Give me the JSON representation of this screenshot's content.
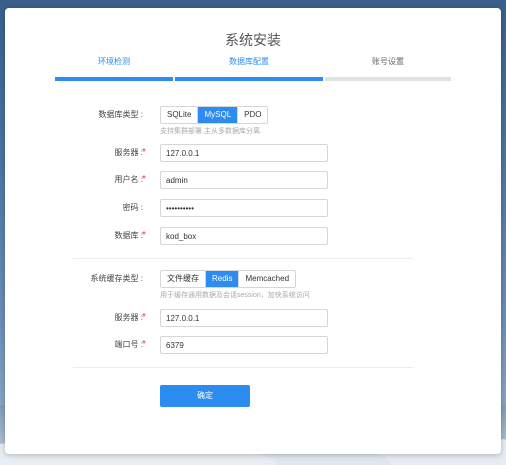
{
  "window": {
    "title": "系统安装"
  },
  "steps": [
    {
      "label": "环境检测",
      "status": "done"
    },
    {
      "label": "数据库配置",
      "status": "active"
    },
    {
      "label": "账号设置",
      "status": "todo"
    }
  ],
  "database": {
    "type_label": "数据库类型 :",
    "type_options": [
      "SQLite",
      "MySQL",
      "PDO"
    ],
    "type_selected": "MySQL",
    "type_hint": "支持集群部署,主从多数据库分离.",
    "server_label": "服务器 :",
    "server_value": "127.0.0.1",
    "user_label": "用户名 :",
    "user_value": "admin",
    "password_label": "密码 :",
    "password_value": "••••••••••",
    "name_label": "数据库 :",
    "name_value": "kod_box",
    "required_mark": "*"
  },
  "cache": {
    "type_label": "系统缓存类型 :",
    "type_options": [
      "文件缓存",
      "Redis",
      "Memcached"
    ],
    "type_selected": "Redis",
    "type_hint": "用于缓存通用数据及会话session，加快系统访问",
    "server_label": "服务器 :",
    "server_value": "127.0.0.1",
    "port_label": "端口号 :",
    "port_value": "6379"
  },
  "actions": {
    "submit_label": "确定"
  },
  "colors": {
    "accent": "#2d8cf0",
    "required": "#e4393c"
  }
}
